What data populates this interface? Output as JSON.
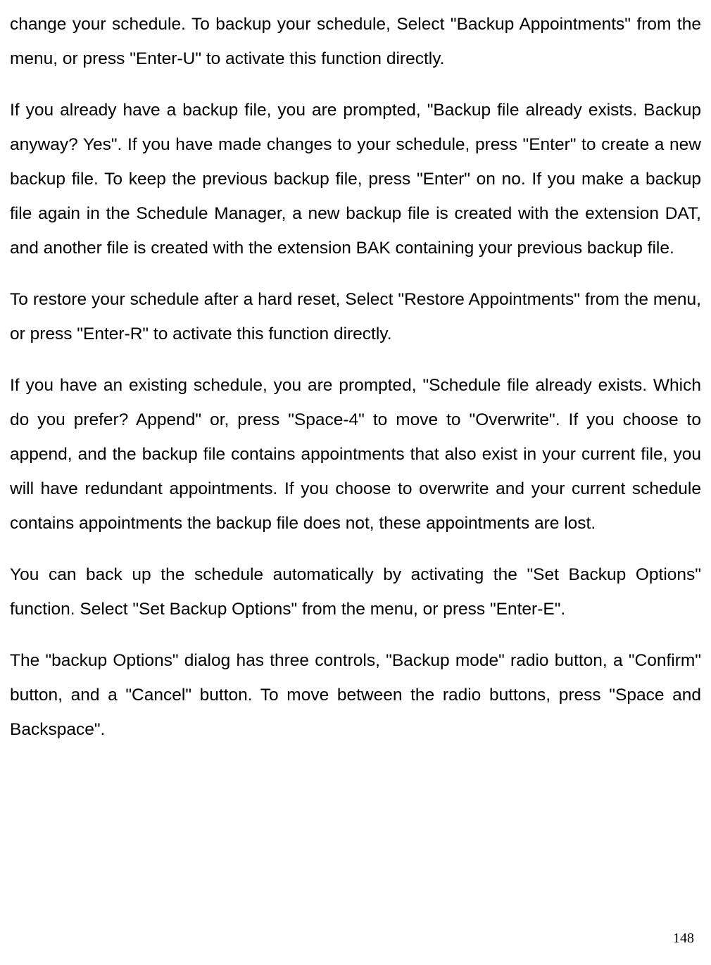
{
  "paragraphs": {
    "p1": "change your schedule. To backup your schedule, Select \"Backup Appointments\" from the menu, or press \"Enter-U\" to activate this function directly.",
    "p2": "If you already have a backup file, you are prompted, \"Backup file already exists. Backup anyway? Yes\". If you have made changes to your schedule, press \"Enter\" to create a new backup file. To keep the previous backup file, press \"Enter\" on no. If you make a backup file again in the Schedule Manager, a new backup file is created with the extension DAT, and another file is created with the extension BAK containing your previous backup file.",
    "p3": "To restore your schedule after a hard reset, Select \"Restore Appointments\" from the menu, or press \"Enter-R\" to activate this function directly.",
    "p4": "If you have an existing schedule, you are prompted, \"Schedule file already exists. Which do you prefer? Append\" or, press \"Space-4\" to move to \"Overwrite\". If you choose to append, and the backup file contains appointments that also exist in your current file, you will have redundant appointments. If you choose to overwrite and your current schedule contains appointments the backup file does not, these appointments are lost.",
    "p5": "You can back up the schedule automatically by activating the \"Set Backup Options\" function. Select \"Set Backup Options\" from the menu, or press \"Enter-E\".",
    "p6": "The \"backup Options\" dialog has three controls, \"Backup mode\" radio button, a \"Confirm\" button, and a \"Cancel\" button. To move between the radio buttons, press \"Space and Backspace\"."
  },
  "pageNumber": "148"
}
